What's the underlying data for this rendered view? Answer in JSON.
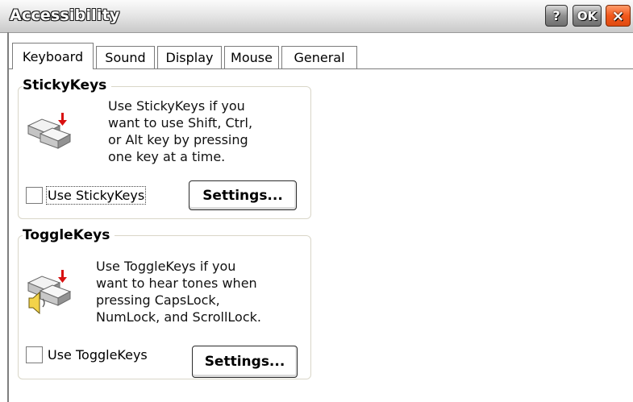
{
  "window": {
    "title": "Accessibility",
    "help_label": "?",
    "ok_label": "OK",
    "close_label": "×"
  },
  "tabs": [
    {
      "label": "Keyboard",
      "active": true
    },
    {
      "label": "Sound",
      "active": false
    },
    {
      "label": "Display",
      "active": false
    },
    {
      "label": "Mouse",
      "active": false
    },
    {
      "label": "General",
      "active": false
    }
  ],
  "stickykeys": {
    "title": "StickyKeys",
    "desc_lines": [
      "Use StickyKeys if you",
      "want to use Shift, Ctrl,",
      "or Alt key by pressing",
      "one key at a time."
    ],
    "checkbox_label": "Use StickyKeys",
    "checked": false,
    "settings_label": "Settings...",
    "icon": "keyboard-key-arrow-icon"
  },
  "togglekeys": {
    "title": "ToggleKeys",
    "desc_lines": [
      "Use ToggleKeys if you",
      "want to hear tones when",
      "pressing CapsLock,",
      "NumLock, and ScrollLock."
    ],
    "checkbox_label": "Use ToggleKeys",
    "checked": false,
    "settings_label": "Settings...",
    "icon": "keyboard-key-speaker-icon"
  },
  "colors": {
    "close_button": "#f2581c",
    "arrow_red": "#d81010"
  }
}
